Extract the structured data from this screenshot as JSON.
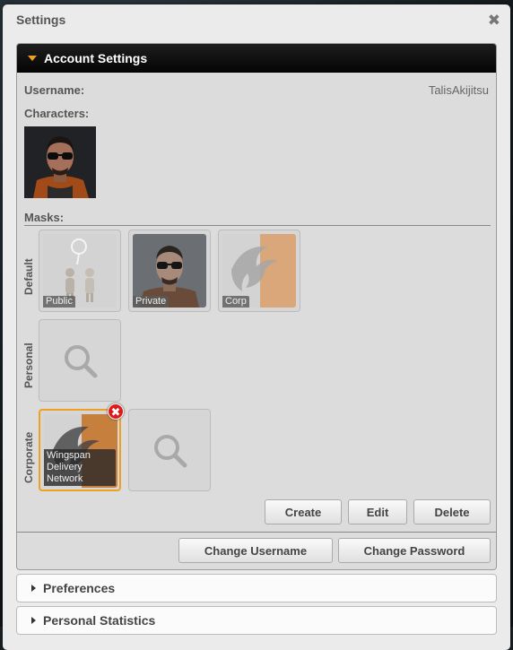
{
  "dialog": {
    "title": "Settings",
    "close_glyph": "✖"
  },
  "account": {
    "header": "Account Settings",
    "username_label": "Username:",
    "username_value": "TalisAkijitsu",
    "characters_label": "Characters:",
    "masks_label": "Masks:"
  },
  "masks": {
    "default_label": "Default",
    "personal_label": "Personal",
    "corporate_label": "Corporate",
    "default_items": [
      {
        "caption": "Public"
      },
      {
        "caption": "Private"
      },
      {
        "caption": "Corp"
      }
    ],
    "corporate_items": [
      {
        "caption": "Wingspan Delivery Network"
      }
    ],
    "remove_glyph": "✖"
  },
  "buttons": {
    "create": "Create",
    "edit": "Edit",
    "delete": "Delete",
    "change_username": "Change Username",
    "change_password": "Change Password"
  },
  "sections": {
    "preferences": "Preferences",
    "personal_statistics": "Personal Statistics"
  },
  "colors": {
    "accent": "#f0a020",
    "remove_badge": "#e01818",
    "header_bg": "#0a0a0a"
  },
  "icons": [
    "close-icon",
    "caret-down-icon",
    "caret-right-icon",
    "search-icon",
    "remove-icon",
    "public-icon",
    "corp-logo-icon"
  ]
}
